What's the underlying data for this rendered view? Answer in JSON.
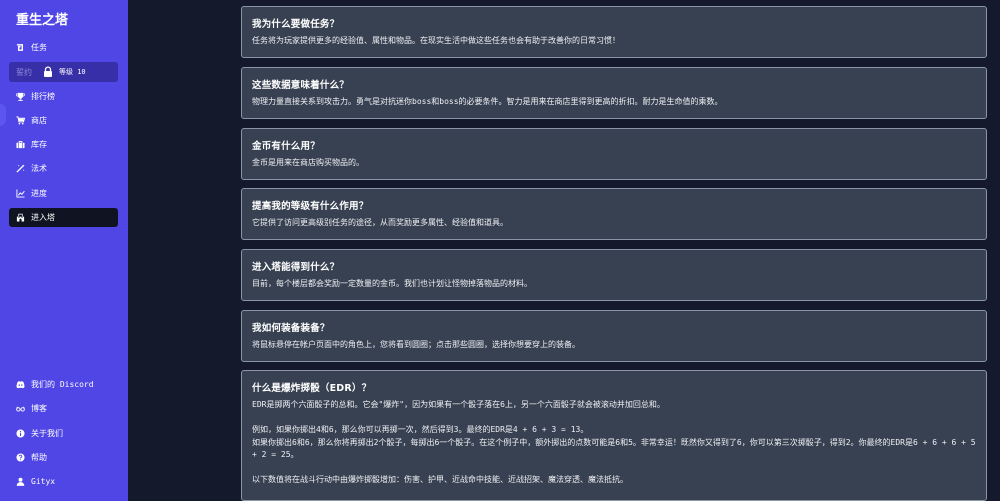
{
  "app_title": "重生之塔",
  "sidebar": {
    "items": [
      {
        "label": "任务",
        "icon": "quest-icon"
      },
      {
        "label": "排行榜",
        "icon": "trophy-icon"
      },
      {
        "label": "商店",
        "icon": "cart-icon"
      },
      {
        "label": "库存",
        "icon": "briefcase-icon"
      },
      {
        "label": "法术",
        "icon": "wand-icon"
      },
      {
        "label": "进度",
        "icon": "chart-icon"
      },
      {
        "label": "进入塔",
        "icon": "tower-icon",
        "active": true
      }
    ],
    "locked_item": {
      "label": "誓约",
      "level_text": "等级 10",
      "icon": "lock-icon"
    },
    "bottom_items": [
      {
        "label": "我们的 Discord",
        "icon": "discord-icon"
      },
      {
        "label": "博客",
        "icon": "glasses-icon"
      },
      {
        "label": "关于我们",
        "icon": "info-icon"
      },
      {
        "label": "帮助",
        "icon": "help-icon"
      },
      {
        "label": "Gityx",
        "icon": "user-icon"
      }
    ]
  },
  "faq": [
    {
      "q": "我为什么要做任务？",
      "a": "任务将为玩家提供更多的经验值、属性和物品。在现实生活中做这些任务也会有助于改善你的日常习惯！"
    },
    {
      "q": "这些数据意味着什么？",
      "a": "物理力量直接关系到攻击力。勇气是对抗迷你boss和boss的必要条件。智力是用来在商店里得到更高的折扣。耐力是生命值的乘数。"
    },
    {
      "q": "金币有什么用？",
      "a": "金币是用来在商店购买物品的。"
    },
    {
      "q": "提高我的等级有什么作用？",
      "a": "它提供了访问更高级别任务的途径，从而奖励更多属性、经验值和道具。"
    },
    {
      "q": "进入塔能得到什么？",
      "a": "目前，每个楼层都会奖励一定数量的金币。我们也计划让怪物掉落物品的材料。"
    },
    {
      "q": "我如何装备装备？",
      "a": "将鼠标悬停在帐户页面中的角色上，您将看到圆圈；点击那些圆圈，选择你想要穿上的装备。"
    },
    {
      "q": "什么是爆炸掷骰（EDR）？",
      "a": "EDR是掷两个六面骰子的总和。它会\"爆炸\"，因为如果有一个骰子落在6上，另一个六面骰子就会被滚动并加回总和。\n\n例如，如果你掷出4和6，那么你可以再掷一次，然后得到3。最终的EDR是4 + 6 + 3 = 13。\n如果你掷出6和6，那么你将再掷出2个骰子，每掷出6一个骰子。在这个例子中，额外掷出的点数可能是6和5。非常幸运！既然你又得到了6，你可以第三次掷骰子，得到2。你最终的EDR是6 + 6 + 6 + 5 + 2 = 25。\n\n以下数值将在战斗行动中由爆炸掷骰增加：伤害、护甲、近战命中技能、近战招架、魔法穿透、魔法抵抗。"
    }
  ]
}
